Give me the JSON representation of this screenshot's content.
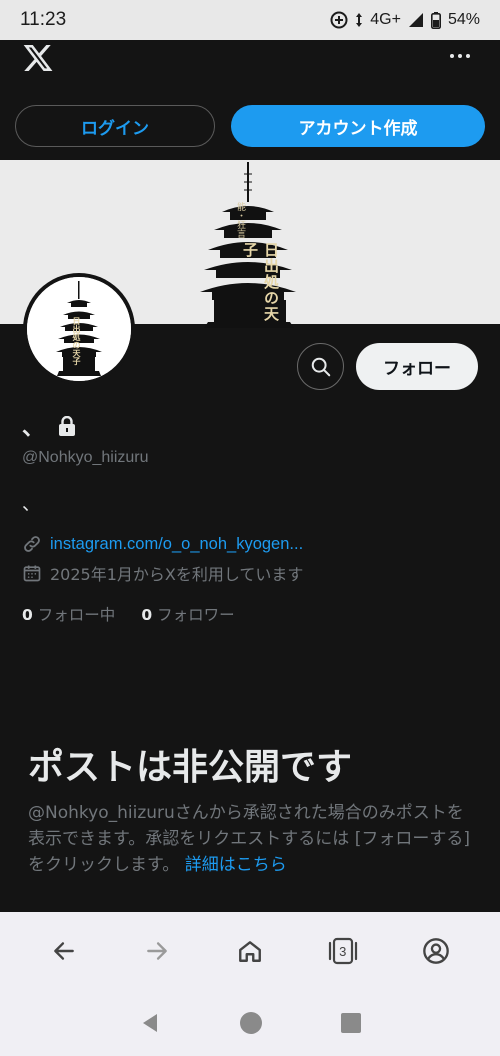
{
  "status": {
    "time": "11:23",
    "network": "4G+",
    "battery": "54%"
  },
  "header": {
    "logo": "x-logo",
    "more_icon": "more-icon"
  },
  "auth": {
    "login_label": "ログイン",
    "signup_label": "アカウント作成"
  },
  "banner": {
    "title_text": "日出処の天子",
    "subtitle_text": "能・狂言"
  },
  "profile": {
    "display_name": "、",
    "username": "@Nohkyo_hiizuru",
    "bio": "、",
    "link": "instagram.com/o_o_noh_kyogen...",
    "joined": "2025年1月からXを利用しています",
    "following_count": "0",
    "following_label": "フォロー中",
    "followers_count": "0",
    "followers_label": "フォロワー",
    "follow_button": "フォロー"
  },
  "private": {
    "title": "ポストは非公開です",
    "body": "@Nohkyo_hiizuruさんから承認された場合のみポストを表示できます。承認をリクエストするには [フォローする] をクリックします。",
    "more_link": "詳細はこちら"
  },
  "browser": {
    "tab_count": "3"
  },
  "colors": {
    "accent": "#1d9bf0",
    "background": "#141414",
    "muted": "#71767b"
  }
}
